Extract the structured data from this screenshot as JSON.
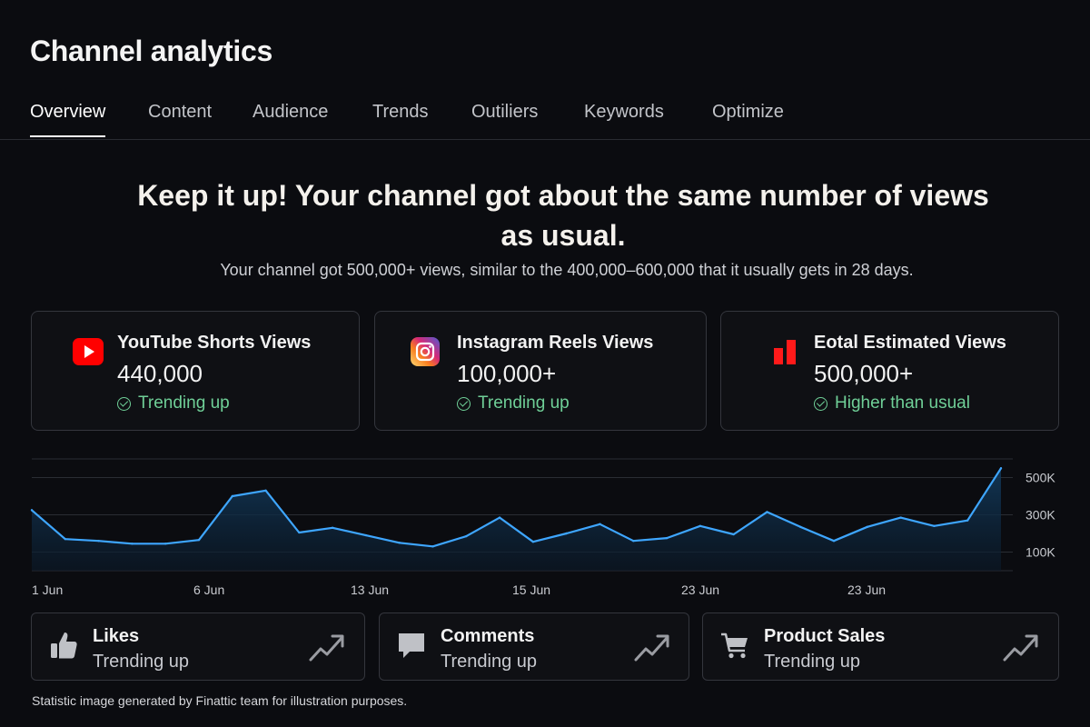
{
  "page": {
    "title": "Channel analytics"
  },
  "tabs": [
    {
      "label": "Overview",
      "active": true
    },
    {
      "label": "Content"
    },
    {
      "label": "Audience"
    },
    {
      "label": "Trends"
    },
    {
      "label": "Outiliers"
    },
    {
      "label": "Keywords"
    },
    {
      "label": "Optimize"
    }
  ],
  "summary": {
    "headline_line1": "Keep it up! Your channel got about the same number of views",
    "headline_line2": "as usual.",
    "subline": "Your channel got 500,000+ views, similar to the 400,000–600,000 that it usually gets in 28 days."
  },
  "stat_cards": [
    {
      "icon": "youtube-icon",
      "label": "YouTube Shorts Views",
      "value": "440,000",
      "status": "Trending up"
    },
    {
      "icon": "instagram-icon",
      "label": "Instagram Reels Views",
      "value": "100,000+",
      "status": "Trending up"
    },
    {
      "icon": "bar-chart-icon",
      "label": "Eotal Estimated Views",
      "value": "500,000+",
      "status": "Higher than usual"
    }
  ],
  "colors": {
    "accent_line": "#3ea6ff",
    "positive": "#6fcf97",
    "youtube_red": "#ff0000",
    "background": "#0b0c10"
  },
  "chart_data": {
    "type": "area",
    "x_tick_labels": [
      "1 Jun",
      "6 Jun",
      "13 Jun",
      "15 Jun",
      "23 Jun",
      "23 Jun"
    ],
    "y_tick_labels": [
      "500K",
      "300K",
      "100K"
    ],
    "y_tick_values": [
      500000,
      300000,
      100000
    ],
    "ylim": [
      0,
      600000
    ],
    "values": [
      325000,
      170000,
      160000,
      145000,
      145000,
      165000,
      400000,
      430000,
      205000,
      230000,
      190000,
      150000,
      130000,
      185000,
      285000,
      155000,
      200000,
      250000,
      160000,
      175000,
      240000,
      195000,
      315000,
      235000,
      160000,
      235000,
      285000,
      240000,
      270000,
      550000
    ],
    "grid": true,
    "legend": "none"
  },
  "metric_cards": [
    {
      "icon": "thumbs-up-icon",
      "label": "Likes",
      "status": "Trending up"
    },
    {
      "icon": "comment-icon",
      "label": "Comments",
      "status": "Trending up"
    },
    {
      "icon": "cart-icon",
      "label": "Product Sales",
      "status": "Trending up"
    }
  ],
  "footnote": "Statistic image generated by Finattic team for illustration purposes."
}
